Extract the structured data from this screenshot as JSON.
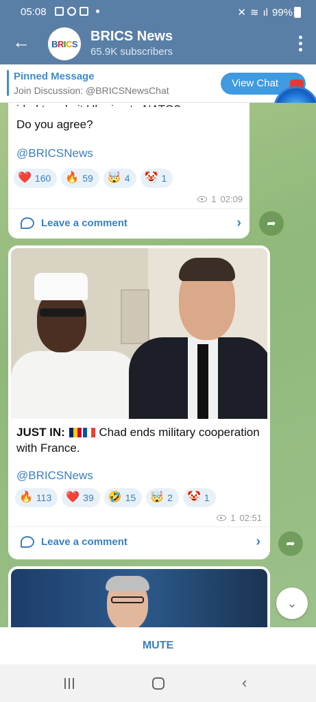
{
  "status_bar": {
    "time": "05:08",
    "battery": "99%"
  },
  "header": {
    "back_icon": "arrow-left-icon",
    "avatar_text": [
      "B",
      "R",
      "I",
      "C",
      "S"
    ],
    "title": "BRICS News",
    "subtitle": "65.9K subscribers"
  },
  "pinned": {
    "label": "Pinned Message",
    "text": "Join Discussion: @BRICSNewsChat",
    "button": "View Chat"
  },
  "posts": [
    {
      "truncated_line": "ided to admit Ukraine to NATO?",
      "text": "Do you agree?",
      "handle": "@BRICSNews",
      "reactions": [
        {
          "emoji": "❤️",
          "count": "160"
        },
        {
          "emoji": "🔥",
          "count": "59"
        },
        {
          "emoji": "🤯",
          "count": "4"
        },
        {
          "emoji": "🤡",
          "count": "1"
        }
      ],
      "views": "1",
      "time": "02:09",
      "comment_label": "Leave a comment"
    },
    {
      "text_bold": "JUST IN:",
      "text": "Chad ends military cooperation with France.",
      "handle": "@BRICSNews",
      "reactions": [
        {
          "emoji": "🔥",
          "count": "113"
        },
        {
          "emoji": "❤️",
          "count": "39"
        },
        {
          "emoji": "🤣",
          "count": "15"
        },
        {
          "emoji": "🤯",
          "count": "2"
        },
        {
          "emoji": "🤡",
          "count": "1"
        }
      ],
      "views": "1",
      "time": "02:51",
      "comment_label": "Leave a comment"
    }
  ],
  "bottom": {
    "mute_label": "MUTE"
  },
  "colors": {
    "header": "#5a7fa6",
    "accent": "#3a7fbf",
    "view_chat": "#3f9ae0"
  }
}
